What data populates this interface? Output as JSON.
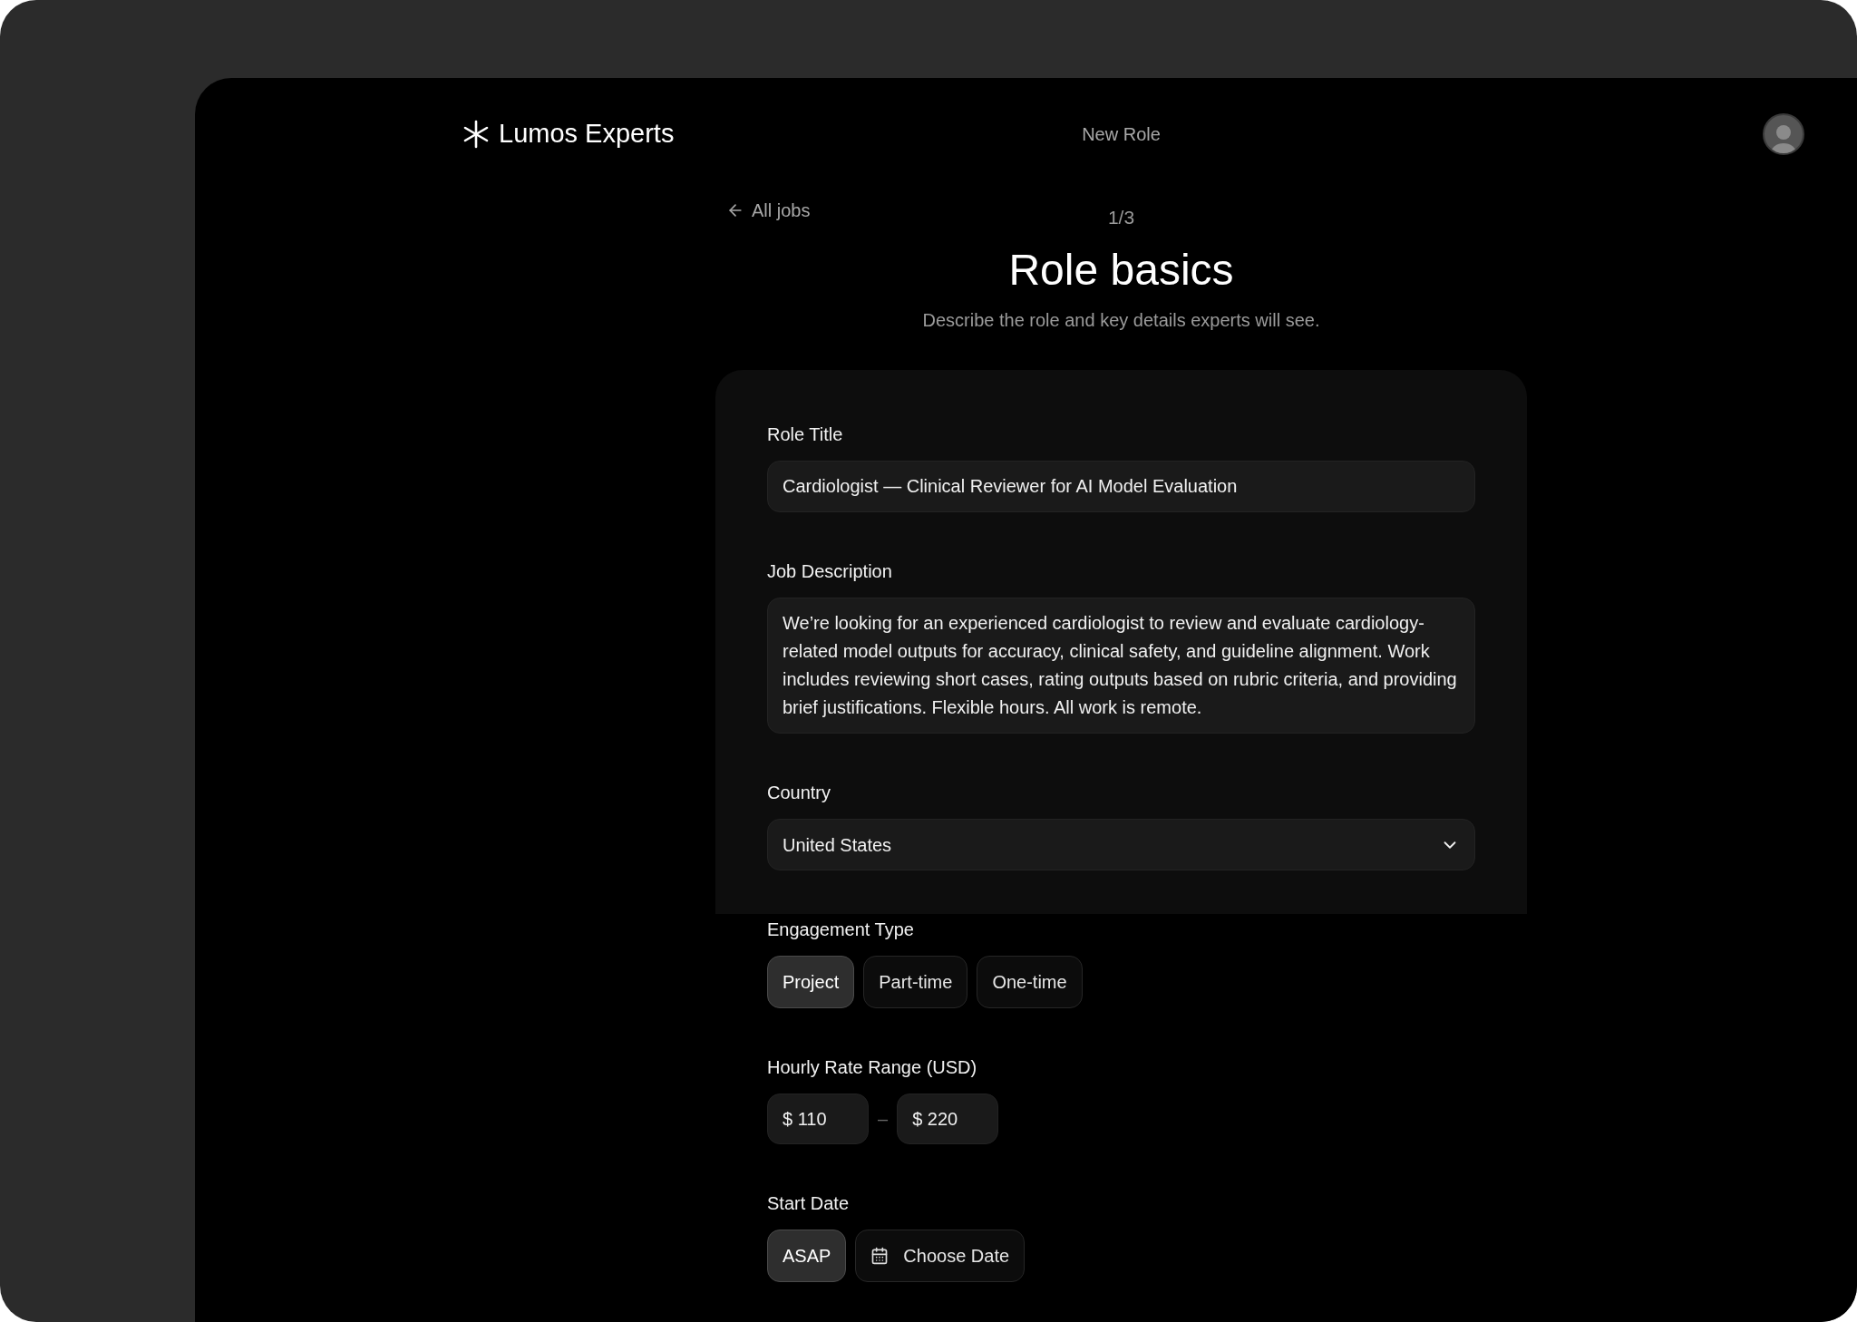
{
  "header": {
    "brand": "Lumos Experts",
    "page_title": "New Role"
  },
  "back_link": "All jobs",
  "step": "1/3",
  "title": "Role basics",
  "subtitle": "Describe the role and key details experts will see.",
  "form": {
    "role_title": {
      "label": "Role Title",
      "value": "Cardiologist — Clinical Reviewer for AI Model Evaluation"
    },
    "job_description": {
      "label": "Job Description",
      "value": "We’re looking for an experienced cardiologist to review and evaluate cardiology-related model outputs for accuracy, clinical safety, and guideline alignment. Work includes reviewing short cases, rating outputs based on rubric criteria, and providing brief justifications. Flexible hours. All work is remote."
    },
    "country": {
      "label": "Country",
      "value": "United States"
    },
    "engagement_type": {
      "label": "Engagement Type",
      "options": [
        {
          "label": "Project",
          "selected": true
        },
        {
          "label": "Part-time",
          "selected": false
        },
        {
          "label": "One-time",
          "selected": false
        }
      ]
    },
    "hourly_rate": {
      "label": "Hourly Rate Range (USD)",
      "min": "$ 110",
      "separator": "–",
      "max": "$ 220"
    },
    "start_date": {
      "label": "Start Date",
      "options": [
        {
          "kind": "plain",
          "label": "ASAP",
          "selected": true
        },
        {
          "kind": "date",
          "label": "Choose Date",
          "selected": false
        }
      ]
    }
  }
}
